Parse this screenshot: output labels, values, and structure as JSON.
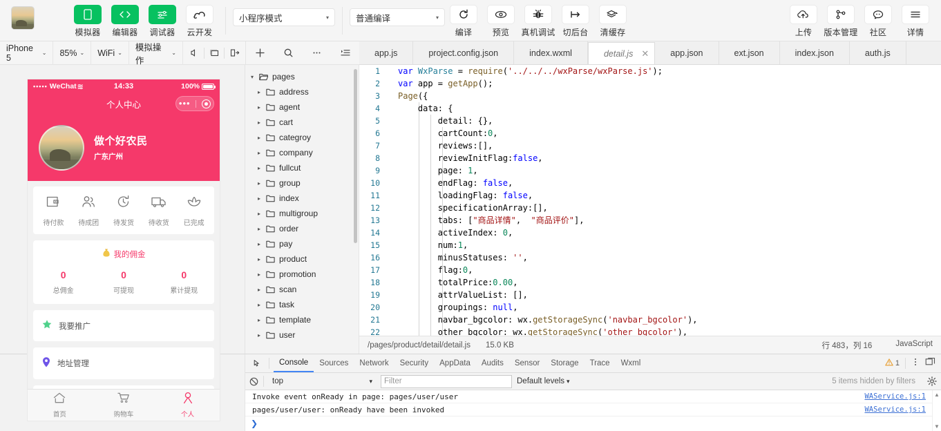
{
  "toolbar": {
    "avatar_name": "user-avatar-thumbnail",
    "buttons": [
      {
        "label": "模拟器",
        "icon": "phone-icon",
        "style": "green"
      },
      {
        "label": "编辑器",
        "icon": "code-brackets-icon",
        "style": "green"
      },
      {
        "label": "调试器",
        "icon": "debugger-icon",
        "style": "green"
      },
      {
        "label": "云开发",
        "icon": "cloud-dev-icon",
        "style": "plain"
      }
    ],
    "compile_mode": {
      "value": "小程序模式",
      "caret": "▾"
    },
    "compile_type": {
      "value": "普通编译",
      "caret": "▾"
    },
    "actions": [
      {
        "label": "编译",
        "icon": "refresh-icon"
      },
      {
        "label": "预览",
        "icon": "eye-icon"
      },
      {
        "label": "真机调试",
        "icon": "bug-icon"
      },
      {
        "label": "切后台",
        "icon": "background-switch-icon"
      },
      {
        "label": "清缓存",
        "icon": "layers-icon",
        "caret": "▾"
      }
    ],
    "right_actions": [
      {
        "label": "上传",
        "icon": "cloud-upload-icon"
      },
      {
        "label": "版本管理",
        "icon": "git-branch-icon"
      },
      {
        "label": "社区",
        "icon": "chat-bubble-icon"
      },
      {
        "label": "详情",
        "icon": "hamburger-icon"
      }
    ]
  },
  "simulator_toolbar": {
    "device": {
      "label": "iPhone 5",
      "caret": "⌄"
    },
    "zoom": {
      "label": "85%",
      "caret": "⌄"
    },
    "network": {
      "label": "WiFi",
      "caret": "⌄"
    },
    "mock": {
      "label": "模拟操作",
      "caret": "⌄"
    },
    "icons": [
      "mute-icon",
      "screen-icon",
      "rotate-icon"
    ]
  },
  "tree_toolbar": {
    "icons": [
      "add-file-icon",
      "search-icon",
      "more-icon",
      "collapse-icon"
    ]
  },
  "editor_tabs": [
    {
      "label": "app.js",
      "active": false
    },
    {
      "label": "project.config.json",
      "active": false
    },
    {
      "label": "index.wxml",
      "active": false
    },
    {
      "label": "detail.js",
      "active": true,
      "close": "✕"
    },
    {
      "label": "app.json",
      "active": false
    },
    {
      "label": "ext.json",
      "active": false
    },
    {
      "label": "index.json",
      "active": false
    },
    {
      "label": "auth.js",
      "active": false
    }
  ],
  "file_tree": [
    {
      "label": "pages",
      "depth": 0,
      "arrow": "▾",
      "open": true
    },
    {
      "label": "address",
      "depth": 1,
      "arrow": "▸",
      "open": false
    },
    {
      "label": "agent",
      "depth": 1,
      "arrow": "▸",
      "open": false
    },
    {
      "label": "cart",
      "depth": 1,
      "arrow": "▸",
      "open": false
    },
    {
      "label": "categroy",
      "depth": 1,
      "arrow": "▸",
      "open": false
    },
    {
      "label": "company",
      "depth": 1,
      "arrow": "▸",
      "open": false
    },
    {
      "label": "fullcut",
      "depth": 1,
      "arrow": "▸",
      "open": false
    },
    {
      "label": "group",
      "depth": 1,
      "arrow": "▸",
      "open": false
    },
    {
      "label": "index",
      "depth": 1,
      "arrow": "▸",
      "open": false
    },
    {
      "label": "multigroup",
      "depth": 1,
      "arrow": "▸",
      "open": false
    },
    {
      "label": "order",
      "depth": 1,
      "arrow": "▸",
      "open": false
    },
    {
      "label": "pay",
      "depth": 1,
      "arrow": "▸",
      "open": false
    },
    {
      "label": "product",
      "depth": 1,
      "arrow": "▸",
      "open": false
    },
    {
      "label": "promotion",
      "depth": 1,
      "arrow": "▸",
      "open": false
    },
    {
      "label": "scan",
      "depth": 1,
      "arrow": "▸",
      "open": false
    },
    {
      "label": "task",
      "depth": 1,
      "arrow": "▸",
      "open": false
    },
    {
      "label": "template",
      "depth": 1,
      "arrow": "▸",
      "open": false
    },
    {
      "label": "user",
      "depth": 1,
      "arrow": "▸",
      "open": false
    }
  ],
  "code": {
    "lines": [
      {
        "n": 1,
        "html": "<span class='kw'>var</span> <span class='cls'>WxParse</span> = <span class='fn'>require</span>(<span class='str'>'../../../wxParse/wxParse.js'</span>);"
      },
      {
        "n": 2,
        "html": "<span class='kw'>var</span> app = <span class='fn'>getApp</span>();"
      },
      {
        "n": 3,
        "html": "<span class='fn'>Page</span>({"
      },
      {
        "n": 4,
        "html": "    data: {"
      },
      {
        "n": 5,
        "html": "        detail: {},"
      },
      {
        "n": 6,
        "html": "        cartCount:<span class='num'>0</span>,"
      },
      {
        "n": 7,
        "html": "        reviews:[],"
      },
      {
        "n": 8,
        "html": "        reviewInitFlag:<span class='kw'>false</span>,"
      },
      {
        "n": 9,
        "html": "        page: <span class='num'>1</span>,"
      },
      {
        "n": 10,
        "html": "        endFlag: <span class='kw'>false</span>,"
      },
      {
        "n": 11,
        "html": "        loadingFlag: <span class='kw'>false</span>,"
      },
      {
        "n": 12,
        "html": "        specificationArray:[],"
      },
      {
        "n": 13,
        "html": "        tabs: [<span class='str'>\"商品详情\"</span>,  <span class='str'>\"商品评价\"</span>],"
      },
      {
        "n": 14,
        "html": "        activeIndex: <span class='num'>0</span>,"
      },
      {
        "n": 15,
        "html": "        num:<span class='num'>1</span>,"
      },
      {
        "n": 16,
        "html": "        minusStatuses: <span class='str'>''</span>,"
      },
      {
        "n": 17,
        "html": "        flag:<span class='num'>0</span>,"
      },
      {
        "n": 18,
        "html": "        totalPrice:<span class='num'>0.00</span>,"
      },
      {
        "n": 19,
        "html": "        attrValueList: [],"
      },
      {
        "n": 20,
        "html": "        groupings: <span class='kw'>null</span>,"
      },
      {
        "n": 21,
        "html": "        navbar_bgcolor: wx.<span class='fn'>getStorageSync</span>(<span class='str'>'navbar_bgcolor'</span>),"
      },
      {
        "n": 22,
        "html": "        other_bgcolor: wx.<span class='fn'>getStorageSync</span>(<span class='str'>'other_bgcolor'</span>),"
      }
    ]
  },
  "editor_status": {
    "path": "/pages/product/detail/detail.js",
    "size": "15.0 KB",
    "position": "行 483，列 16",
    "language": "JavaScript"
  },
  "devtools": {
    "tabs": [
      {
        "label": "Console",
        "active": true
      },
      {
        "label": "Sources",
        "active": false
      },
      {
        "label": "Network",
        "active": false
      },
      {
        "label": "Security",
        "active": false
      },
      {
        "label": "AppData",
        "active": false
      },
      {
        "label": "Audits",
        "active": false
      },
      {
        "label": "Sensor",
        "active": false
      },
      {
        "label": "Storage",
        "active": false
      },
      {
        "label": "Trace",
        "active": false
      },
      {
        "label": "Wxml",
        "active": false
      }
    ],
    "warning_count": "1",
    "filters": {
      "context": "top",
      "context_caret": "▾",
      "filter_placeholder": "Filter",
      "filter_value": "",
      "levels": "Default levels",
      "levels_caret": "▾",
      "hidden_note": "5 items hidden by filters"
    },
    "logs": [
      {
        "text": "Invoke event onReady in page: pages/user/user",
        "source": "WAService.js:1"
      },
      {
        "text": "pages/user/user: onReady have been invoked",
        "source": "WAService.js:1"
      }
    ],
    "prompt": "❯"
  },
  "simulator": {
    "status": {
      "dots": "•••••",
      "carrier": "WeChat",
      "wifi": "≋",
      "time": "14:33",
      "battery": "100%"
    },
    "nav_title": "个人中心",
    "profile": {
      "name": "做个好农民",
      "location": "广东广州"
    },
    "order_items": [
      {
        "label": "待付款",
        "icon": "wallet-icon"
      },
      {
        "label": "待成团",
        "icon": "group-icon"
      },
      {
        "label": "待发货",
        "icon": "clock-icon"
      },
      {
        "label": "待收货",
        "icon": "truck-icon"
      },
      {
        "label": "已完成",
        "icon": "flower-icon"
      }
    ],
    "commission": {
      "title": "我的佣金",
      "icon": "money-bag-icon",
      "stats": [
        {
          "num": "0",
          "label": "总佣金"
        },
        {
          "num": "0",
          "label": "可提现"
        },
        {
          "num": "0",
          "label": "累计提现"
        }
      ]
    },
    "menu": [
      {
        "label": "我要推广",
        "icon": "star-icon",
        "color": "#4fd18b"
      },
      {
        "label": "地址管理",
        "icon": "location-pin-icon",
        "color": "#6f55e8"
      }
    ],
    "tabbar": [
      {
        "label": "首页",
        "icon": "home-icon",
        "active": false
      },
      {
        "label": "购物车",
        "icon": "cart-icon",
        "active": false
      },
      {
        "label": "个人",
        "icon": "person-icon",
        "active": true
      }
    ]
  },
  "colors": {
    "brand_green": "#07c160",
    "wechat_pink": "#f5396a",
    "devtools_accent": "#4285f4",
    "warning": "#e8a33d"
  }
}
